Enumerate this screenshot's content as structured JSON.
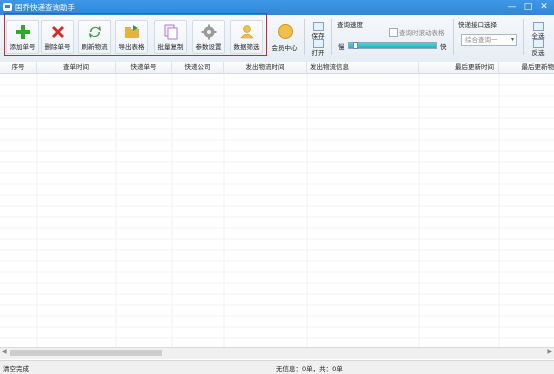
{
  "window": {
    "title": "国乔快递查询助手",
    "controls": [
      "—",
      "□",
      "✕"
    ]
  },
  "toolbar": {
    "buttons": [
      {
        "label": "添加单号",
        "icon": "plus-icon",
        "color": "#2faa2f"
      },
      {
        "label": "删除单号",
        "icon": "delete-x-icon",
        "color": "#d8282a"
      },
      {
        "label": "刷新物流",
        "icon": "refresh-icon",
        "color": "#3a9a3a"
      },
      {
        "label": "导出表格",
        "icon": "export-folder-icon",
        "color": "#e6b43a"
      },
      {
        "label": "批量复制",
        "icon": "copy-icon",
        "color": "#b07ad8"
      },
      {
        "label": "参数设置",
        "icon": "gear-icon",
        "color": "#8a8a8a"
      },
      {
        "label": "数据筛选",
        "icon": "filter-user-icon",
        "color": "#f0c14a"
      }
    ],
    "member_center": "会员中心",
    "save": "保存",
    "open": "打开",
    "speed_group": {
      "label": "查询速度",
      "checkbox": "查询时滚动表格",
      "slow": "慢",
      "fast": "快",
      "level": 0.05
    },
    "interface_group": {
      "label": "快递接口选择",
      "selected": "综合查询一"
    },
    "select_all": "全选",
    "invert": "反选"
  },
  "table": {
    "columns": [
      "序号",
      "查单时间",
      "快递单号",
      "快递公司",
      "发出物流时间",
      "发出物流信息",
      "最后更新时间",
      "最后更新物"
    ]
  },
  "status": {
    "left": "清空完成",
    "center": "无信息：0单，共：0单"
  }
}
